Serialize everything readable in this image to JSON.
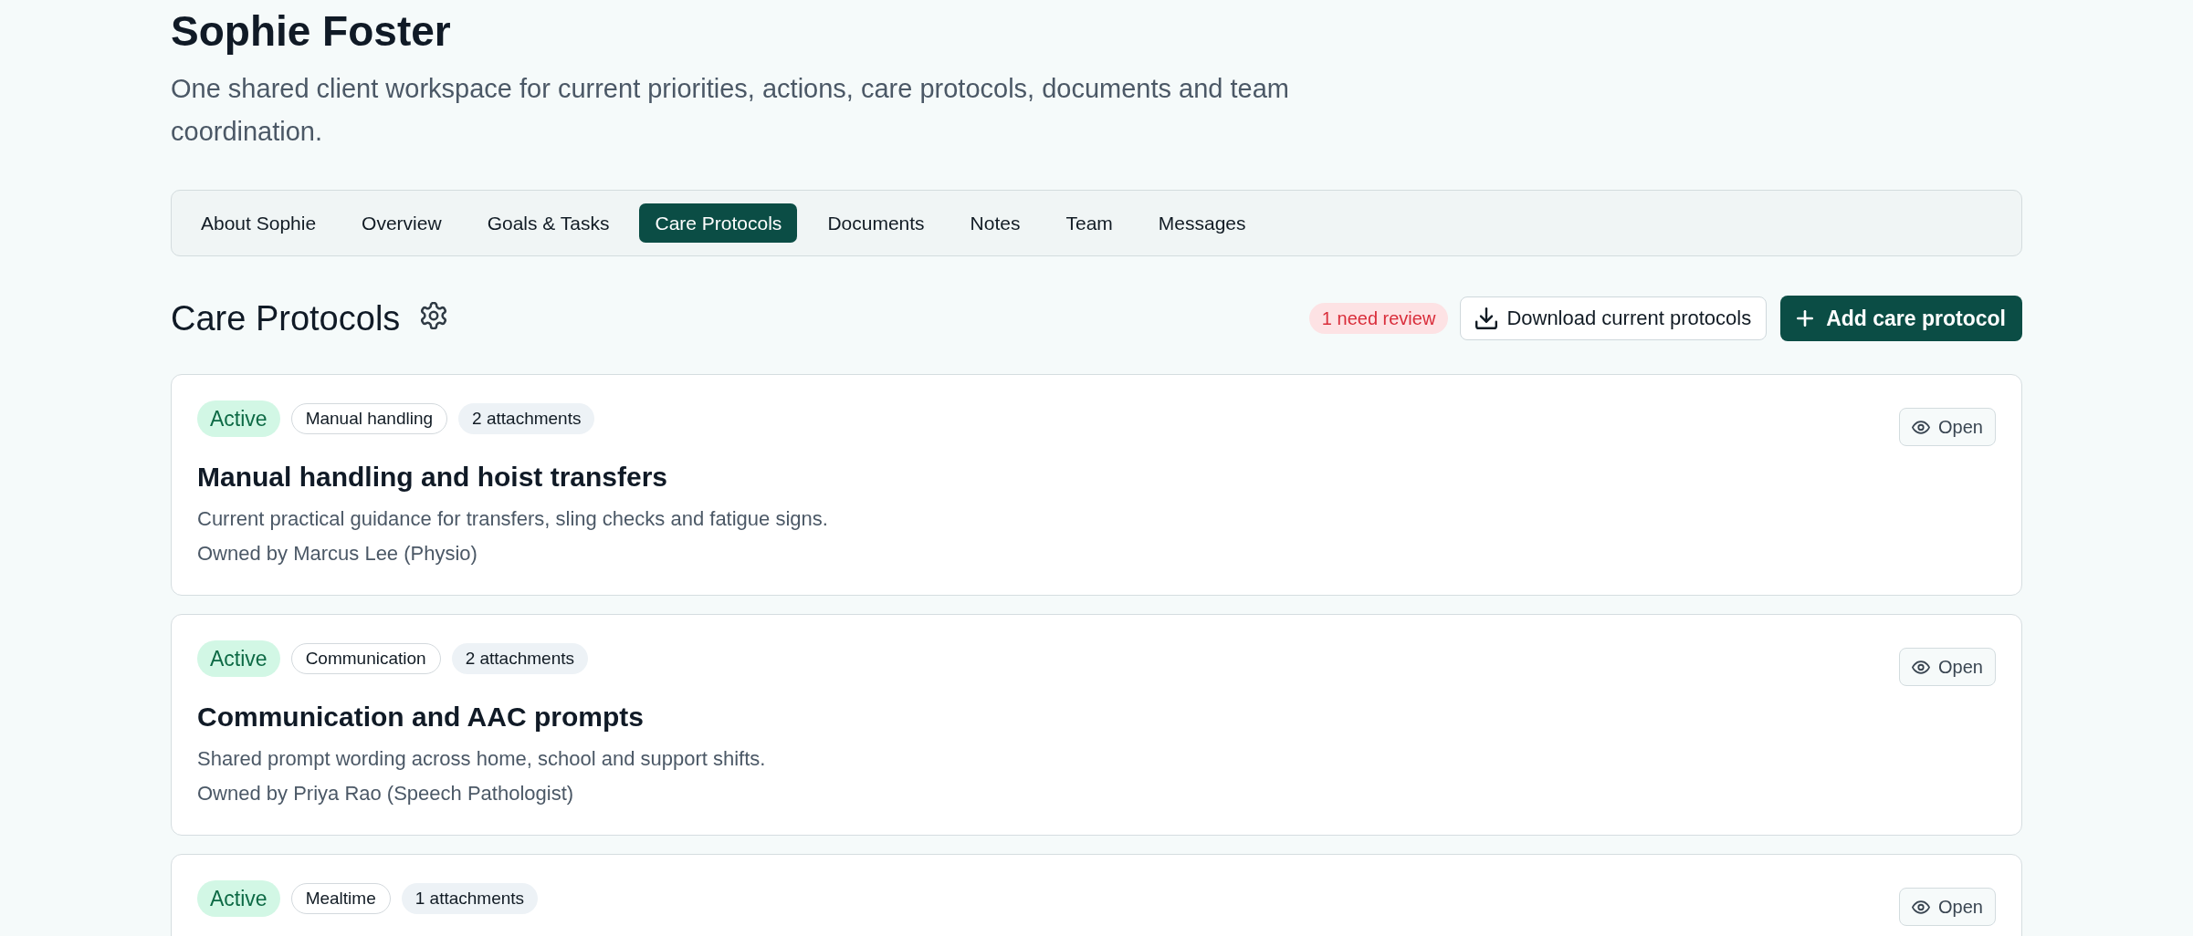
{
  "client": {
    "name": "Sophie Foster",
    "subtitle": "One shared client workspace for current priorities, actions, care protocols, documents and team coordination."
  },
  "tabs": [
    {
      "label": "About Sophie",
      "selected": false
    },
    {
      "label": "Overview",
      "selected": false
    },
    {
      "label": "Goals & Tasks",
      "selected": false
    },
    {
      "label": "Care Protocols",
      "selected": true
    },
    {
      "label": "Documents",
      "selected": false
    },
    {
      "label": "Notes",
      "selected": false
    },
    {
      "label": "Team",
      "selected": false
    },
    {
      "label": "Messages",
      "selected": false
    }
  ],
  "section": {
    "title": "Care Protocols",
    "review_badge": "1 need review",
    "download_button": "Download current protocols",
    "add_button": "Add care protocol"
  },
  "protocols": [
    {
      "status": "Active",
      "category": "Manual handling",
      "attachments": "2 attachments",
      "title": "Manual handling and hoist transfers",
      "description": "Current practical guidance for transfers, sling checks and fatigue signs.",
      "owner": "Owned by Marcus Lee (Physio)",
      "open_button": "Open"
    },
    {
      "status": "Active",
      "category": "Communication",
      "attachments": "2 attachments",
      "title": "Communication and AAC prompts",
      "description": "Shared prompt wording across home, school and support shifts.",
      "owner": "Owned by Priya Rao (Speech Pathologist)",
      "open_button": "Open"
    },
    {
      "status": "Active",
      "category": "Mealtime",
      "attachments": "1 attachments",
      "open_button": "Open"
    }
  ]
}
